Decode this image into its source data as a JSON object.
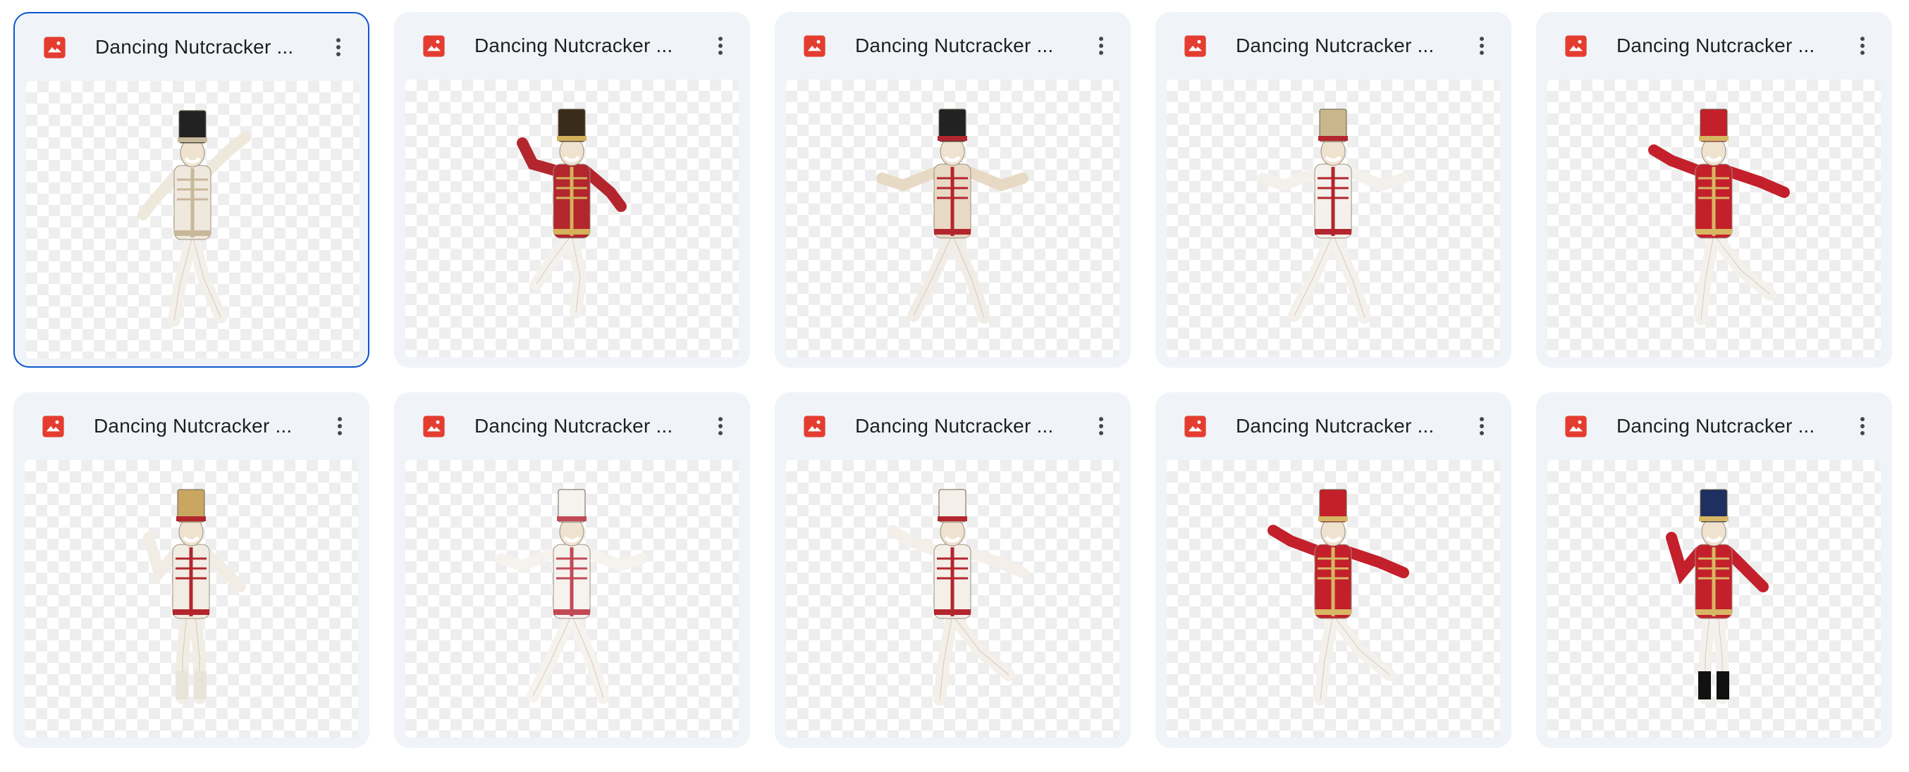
{
  "files": [
    {
      "name": "Dancing Nutcracker ...",
      "selected": true,
      "palette": {
        "coat": "#efe8dc",
        "hat": "#222222",
        "trim": "#c8b89a",
        "pants": "#f3f0ea",
        "boots": "#1d1d1d"
      },
      "pose": "skip"
    },
    {
      "name": "Dancing Nutcracker ...",
      "selected": false,
      "palette": {
        "coat": "#b3262e",
        "hat": "#3a2c1a",
        "trim": "#d4b15a",
        "pants": "#f4f1ec",
        "boots": "#1d1d1d"
      },
      "pose": "kneel"
    },
    {
      "name": "Dancing Nutcracker ...",
      "selected": false,
      "palette": {
        "coat": "#e8d9c4",
        "hat": "#222222",
        "trim": "#b3262e",
        "pants": "#f1ede6",
        "boots": "#151515"
      },
      "pose": "wide"
    },
    {
      "name": "Dancing Nutcracker ...",
      "selected": false,
      "palette": {
        "coat": "#f4f1ec",
        "hat": "#c9b68a",
        "trim": "#b3262e",
        "pants": "#f4f1ec",
        "boots": "#2a2a2a"
      },
      "pose": "wide"
    },
    {
      "name": "Dancing Nutcracker ...",
      "selected": false,
      "palette": {
        "coat": "#c3202b",
        "hat": "#c3202b",
        "trim": "#d8b764",
        "pants": "#f4f1ec",
        "boots": "#2a2a2a"
      },
      "pose": "kick"
    },
    {
      "name": "Dancing Nutcracker ...",
      "selected": false,
      "palette": {
        "coat": "#f2ede4",
        "hat": "#c9a760",
        "trim": "#b3262e",
        "pants": "#f2ede4",
        "boots": "#e9e4da"
      },
      "pose": "stand"
    },
    {
      "name": "Dancing Nutcracker ...",
      "selected": false,
      "palette": {
        "coat": "#f6f3ee",
        "hat": "#f6f3ee",
        "trim": "#c24a55",
        "pants": "#f6f3ee",
        "boots": "#f6f3ee"
      },
      "pose": "wide"
    },
    {
      "name": "Dancing Nutcracker ...",
      "selected": false,
      "palette": {
        "coat": "#f4efe8",
        "hat": "#f4efe8",
        "trim": "#b3262e",
        "pants": "#f4efe8",
        "boots": "#c3202b"
      },
      "pose": "kick"
    },
    {
      "name": "Dancing Nutcracker ...",
      "selected": false,
      "palette": {
        "coat": "#c3202b",
        "hat": "#c3202b",
        "trim": "#d8b764",
        "pants": "#f4f1ec",
        "boots": "#1d1d1d"
      },
      "pose": "kick"
    },
    {
      "name": "Dancing Nutcracker ...",
      "selected": false,
      "palette": {
        "coat": "#c3202b",
        "hat": "#1f2f5f",
        "trim": "#d8b764",
        "pants": "#f4f1ec",
        "boots": "#111111"
      },
      "pose": "stand"
    }
  ],
  "icons": {
    "file_type": "image-file-icon",
    "menu": "more-vert-icon"
  },
  "colors": {
    "image_icon": "#e43d30",
    "selection_border": "#0b57d0",
    "card_bg": "#f0f4f9",
    "text": "#1f1f1f"
  }
}
